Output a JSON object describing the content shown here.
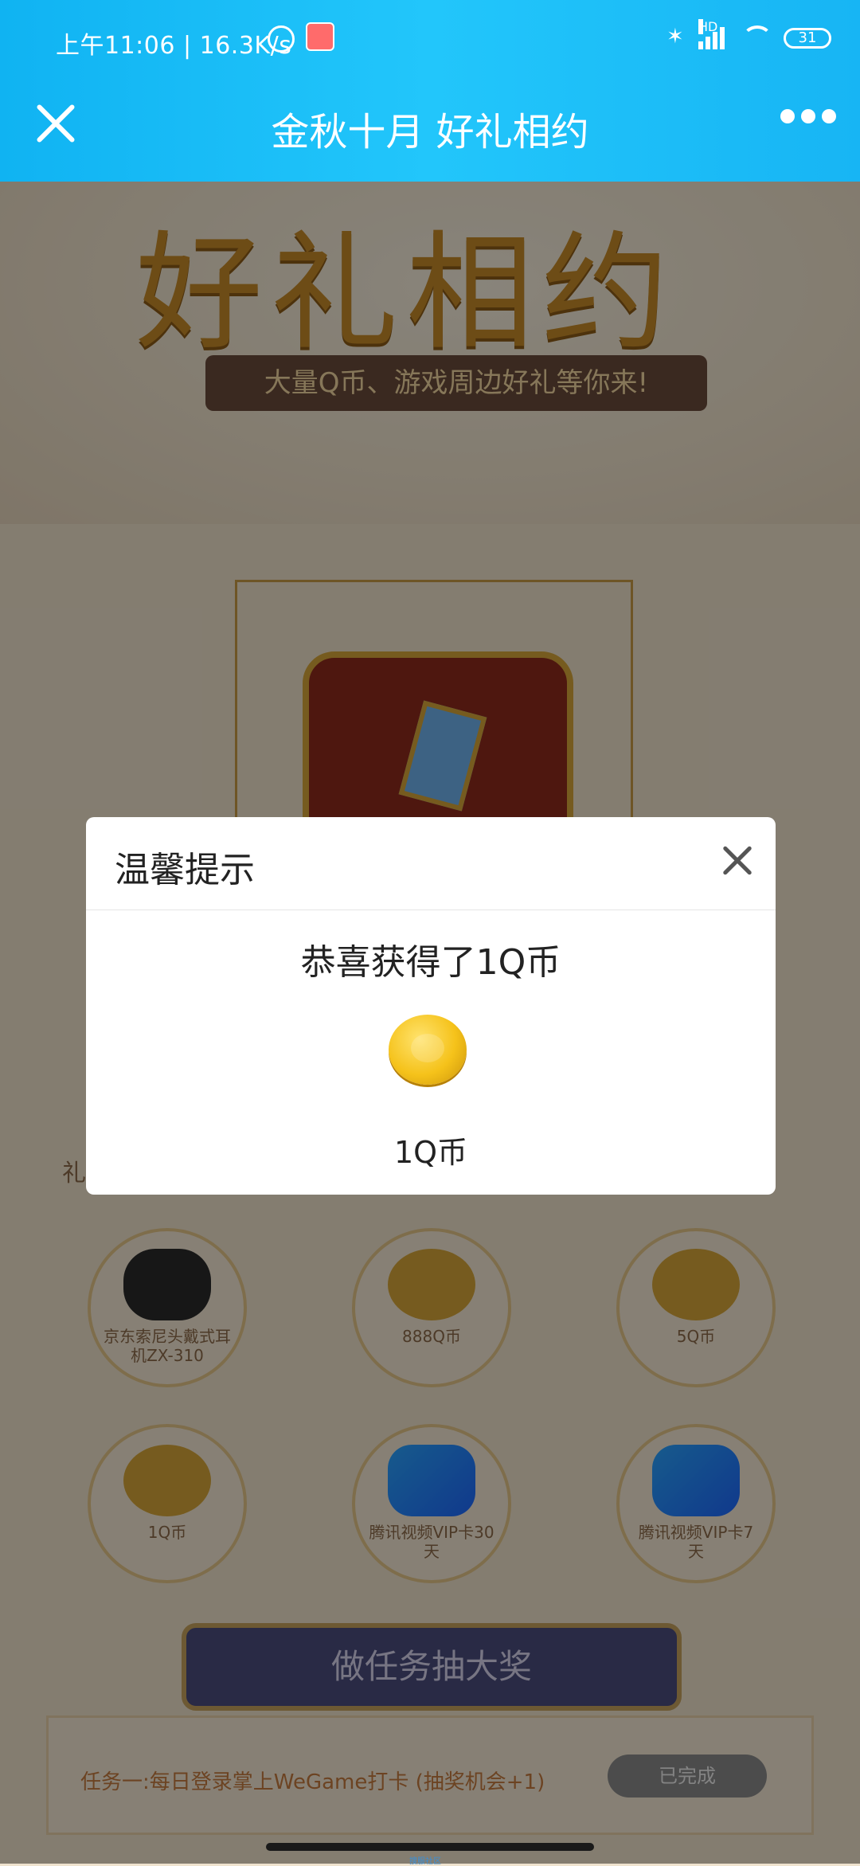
{
  "status_bar": {
    "time_and_speed": "上午11:06 | 16.3K/s",
    "hd_label": "HD",
    "battery": "31"
  },
  "nav": {
    "title": "金秋十月 好礼相约"
  },
  "page": {
    "hero_title": "好礼相约",
    "hero_subtitle": "大量Q币、游戏周边好礼等你来!",
    "section_label": "礼",
    "prizes": [
      {
        "name": "京东索尼头戴式耳机ZX-310",
        "icon": "headphones-icon"
      },
      {
        "name": "888Q币",
        "icon": "coin-stack-icon"
      },
      {
        "name": "5Q币",
        "icon": "coins-icon"
      },
      {
        "name": "1Q币",
        "icon": "coin-icon"
      },
      {
        "name": "腾讯视频VIP卡30天",
        "icon": "tencent-video-icon"
      },
      {
        "name": "腾讯视频VIP卡7天",
        "icon": "tencent-video-icon"
      }
    ],
    "task_button": "做任务抽大奖",
    "task1_text": "任务一:每日登录掌上WeGame打卡 (抽奖机会+1)",
    "task1_status": "已完成"
  },
  "dialog": {
    "title": "温馨提示",
    "message": "恭喜获得了1Q币",
    "prize_label": "1Q币"
  },
  "footer": {
    "tiny_text": "搜服社区"
  }
}
